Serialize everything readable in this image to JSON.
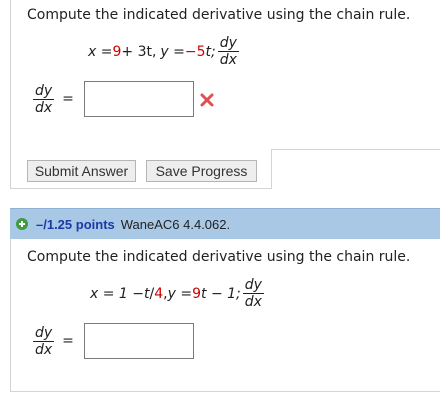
{
  "question1": {
    "prompt": "Compute the indicated derivative using the chain rule.",
    "eq_x_lhs": "x = ",
    "eq_x_a": "9",
    "eq_x_b": " + 3t, ",
    "eq_y_lhs": "y = ",
    "eq_y_a": "−5",
    "eq_y_b": "t; ",
    "deriv_num": "dy",
    "deriv_den": "dx",
    "answer_label_num": "dy",
    "answer_label_den": "dx",
    "equals": "=",
    "answer_value": "",
    "status_icon": "red-x-icon",
    "submit_label": "Submit Answer",
    "save_label": "Save Progress"
  },
  "question2": {
    "expand_icon": "plus-circle-icon",
    "points": "–/1.25 points",
    "question_id": "WaneAC6 4.4.062.",
    "prompt": "Compute the indicated derivative using the chain rule.",
    "eq_x_lhs": "x = 1 − ",
    "eq_x_a": "t",
    "eq_x_div": "/",
    "eq_x_b": "4",
    "eq_sep": ", ",
    "eq_y_lhs": "y = ",
    "eq_y_a": "9",
    "eq_y_b": "t − 1; ",
    "deriv_num": "dy",
    "deriv_den": "dx",
    "answer_label_num": "dy",
    "answer_label_den": "dx",
    "equals": "=",
    "answer_value": ""
  },
  "colors": {
    "header_bg": "#a9c8e6",
    "points_text": "#1a3aa8",
    "highlight_red": "#cc0000",
    "error_icon": "#e05050",
    "expand_icon": "#3f9b3f"
  }
}
